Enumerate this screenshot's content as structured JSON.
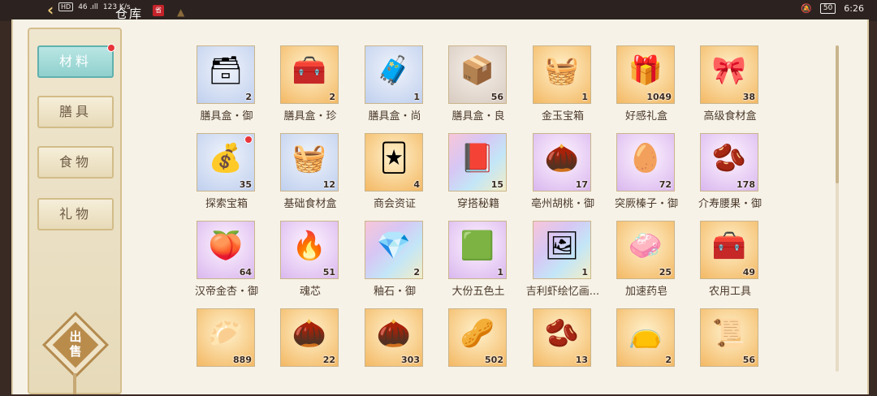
{
  "status_bar": {
    "hd1": "HD",
    "hd2": "HD",
    "signal": "46 .ıll",
    "rate": "123 K/s",
    "battery": "50",
    "time": "6:26"
  },
  "header": {
    "back_icon": "back-arrow-icon",
    "title": "仓库",
    "badge": "省",
    "hat_icon": "hat-icon"
  },
  "sidebar": {
    "categories": [
      {
        "label": "材料",
        "active": true,
        "has_dot": true
      },
      {
        "label": "膳具",
        "active": false,
        "has_dot": false
      },
      {
        "label": "食物",
        "active": false,
        "has_dot": false
      },
      {
        "label": "礼物",
        "active": false,
        "has_dot": false
      }
    ],
    "sell_label": "出售"
  },
  "items": [
    {
      "name": "膳具盒・御",
      "qty": "2",
      "rarity": "blue",
      "icon": "lacquer-box-icon",
      "glyph": "🗃"
    },
    {
      "name": "膳具盒・珍",
      "qty": "2",
      "rarity": "gold",
      "icon": "red-box-icon",
      "glyph": "🧰"
    },
    {
      "name": "膳具盒・尚",
      "qty": "1",
      "rarity": "blue",
      "icon": "red-chest-icon",
      "glyph": "🧳"
    },
    {
      "name": "膳具盒・良",
      "qty": "56",
      "rarity": "gray",
      "icon": "wood-box-icon",
      "glyph": "📦"
    },
    {
      "name": "金玉宝箱",
      "qty": "1",
      "rarity": "gold",
      "icon": "treasure-basket-icon",
      "glyph": "🧺"
    },
    {
      "name": "好感礼盒",
      "qty": "1049",
      "rarity": "gold",
      "icon": "gift-box-icon",
      "glyph": "🎁"
    },
    {
      "name": "高级食材盒",
      "qty": "38",
      "rarity": "gold",
      "icon": "food-box-icon",
      "glyph": "🎀"
    },
    {
      "name": "探索宝箱",
      "qty": "35",
      "rarity": "blue",
      "icon": "explore-chest-icon",
      "glyph": "💰",
      "has_dot": true
    },
    {
      "name": "基础食材盒",
      "qty": "12",
      "rarity": "blue",
      "icon": "basket-icon",
      "glyph": "🧺"
    },
    {
      "name": "商会资证",
      "qty": "4",
      "rarity": "gold",
      "icon": "card-icon",
      "glyph": "🃏"
    },
    {
      "name": "穿搭秘籍",
      "qty": "15",
      "rarity": "rainbow",
      "icon": "book-icon",
      "glyph": "📕"
    },
    {
      "name": "亳州胡桃・御",
      "qty": "17",
      "rarity": "purple",
      "icon": "walnut-icon",
      "glyph": "🌰"
    },
    {
      "name": "突厥榛子・御",
      "qty": "72",
      "rarity": "purple",
      "icon": "hazelnut-icon",
      "glyph": "🥚"
    },
    {
      "name": "介寿腰果・御",
      "qty": "178",
      "rarity": "purple",
      "icon": "cashew-icon",
      "glyph": "🫘"
    },
    {
      "name": "汉帝金杏・御",
      "qty": "64",
      "rarity": "purple",
      "icon": "apricot-icon",
      "glyph": "🍑"
    },
    {
      "name": "魂芯",
      "qty": "51",
      "rarity": "purple",
      "icon": "soul-flame-icon",
      "glyph": "🔥"
    },
    {
      "name": "釉石・御",
      "qty": "2",
      "rarity": "rainbow",
      "icon": "glaze-stone-icon",
      "glyph": "💎"
    },
    {
      "name": "大份五色土",
      "qty": "1",
      "rarity": "purple",
      "icon": "soil-icon",
      "glyph": "🟩"
    },
    {
      "name": "吉利虾绘忆画...",
      "qty": "1",
      "rarity": "rainbow",
      "icon": "painting-icon",
      "glyph": "🖼"
    },
    {
      "name": "加速药皂",
      "qty": "25",
      "rarity": "gold",
      "icon": "soap-icon",
      "glyph": "🧼"
    },
    {
      "name": "农用工具",
      "qty": "49",
      "rarity": "gold",
      "icon": "toolbox-icon",
      "glyph": "🧰"
    },
    {
      "name": "",
      "qty": "889",
      "rarity": "gold",
      "icon": "dumpling-icon",
      "glyph": "🥟"
    },
    {
      "name": "",
      "qty": "22",
      "rarity": "gold",
      "icon": "walnut-gold-icon",
      "glyph": "🌰"
    },
    {
      "name": "",
      "qty": "303",
      "rarity": "gold",
      "icon": "hazelnut-gold-icon",
      "glyph": "🌰"
    },
    {
      "name": "",
      "qty": "502",
      "rarity": "gold",
      "icon": "cashew-gold-icon",
      "glyph": "🥜"
    },
    {
      "name": "",
      "qty": "13",
      "rarity": "gold",
      "icon": "apricot-gold-icon",
      "glyph": "🫘"
    },
    {
      "name": "",
      "qty": "2",
      "rarity": "gold",
      "icon": "cloth-bag-icon",
      "glyph": "👝"
    },
    {
      "name": "",
      "qty": "56",
      "rarity": "gold",
      "icon": "recipe-scroll-icon",
      "glyph": "📜"
    }
  ]
}
